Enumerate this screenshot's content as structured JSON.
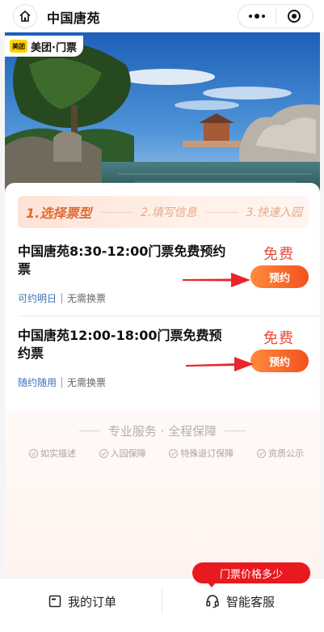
{
  "navbar": {
    "title": "中国唐苑"
  },
  "brand": {
    "logo_text": "美团",
    "name": "美团·门票"
  },
  "steps": [
    "1.选择票型",
    "2.填写信息",
    "3.快速入园"
  ],
  "tickets": [
    {
      "title": "中国唐苑8:30-12:00门票免费预约票",
      "price": "免费",
      "button": "预约",
      "tag1": "可约明日",
      "tag2": "无需换票"
    },
    {
      "title": "中国唐苑12:00-18:00门票免费预约票",
      "price": "免费",
      "button": "预约",
      "tag1": "随约随用",
      "tag2": "无需换票"
    }
  ],
  "guarantee": {
    "title": "专业服务 · 全程保障",
    "items": [
      "如实描述",
      "入园保障",
      "特殊退订保障",
      "资质公示"
    ]
  },
  "bottom": {
    "orders": "我的订单",
    "service": "智能客服",
    "bubble": "门票价格多少"
  },
  "colors": {
    "accent": "#f2521c",
    "price": "#e84b3c",
    "tag_blue": "#3a73b8",
    "bubble_red": "#e8191f",
    "arrow_red": "#e8262b"
  }
}
